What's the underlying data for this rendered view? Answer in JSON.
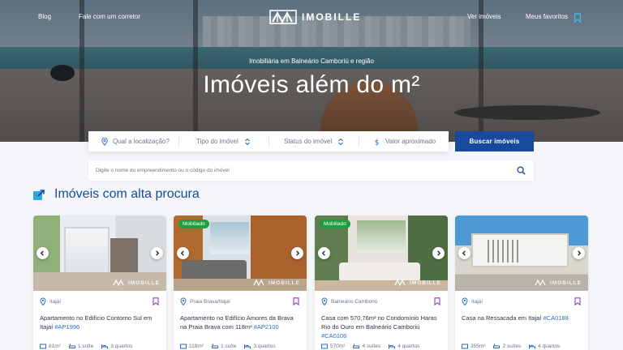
{
  "brand": {
    "name": "IMOBILLE",
    "accent": "#174a9e",
    "link_color": "#2f6bc4",
    "badge_color": "#1e9e3e"
  },
  "nav": {
    "left": [
      {
        "label": "Blog"
      },
      {
        "label": "Fale com um corretor"
      }
    ],
    "right": [
      {
        "label": "Ver imóveis"
      },
      {
        "label": "Meus favoritos",
        "icon": "bookmark-icon"
      }
    ]
  },
  "hero": {
    "subtitle": "Imobiliária em Balneário Camboriú e região",
    "title": "Imóveis além do m²"
  },
  "search": {
    "location_placeholder": "Qual a localização?",
    "type_label": "Tipo do imóvel",
    "status_label": "Status do imóvel",
    "price_label": "Valor aproximado",
    "button_label": "Buscar imóveis",
    "code_placeholder": "Digite o nome do empreendimento ou o código do imóvel"
  },
  "section": {
    "title": "Imóveis com alta procura",
    "icon": "trending-arrow-icon"
  },
  "cards": [
    {
      "badge": "",
      "location": "Itajaí",
      "title": "Apartamento no Edifício Contorno Sul em Itajaí",
      "code": "#AP1996",
      "area": "81m²",
      "suites": "1 suíte",
      "rooms": "3 quartos",
      "watermark": "IMOBILLE"
    },
    {
      "badge": "Mobiliado",
      "location": "Praia Brava/Itajaí",
      "title": "Apartamento no Edifício Amores da Brava na Praia Brava com 118m²",
      "code": "#AP2100",
      "area": "118m²",
      "suites": "1 suíte",
      "rooms": "3 quartos",
      "watermark": "IMOBILLE"
    },
    {
      "badge": "Mobiliado",
      "location": "Balneário Camboriú",
      "title": "Casa com 570,76m² no Condomínio Haras Rio do Ouro em Balneário Camboriú",
      "code": "#CA0106",
      "area": "570m²",
      "suites": "4 suítes",
      "rooms": "4 quartos",
      "watermark": "IMOBILLE"
    },
    {
      "badge": "",
      "location": "Itajaí",
      "title": "Casa na Ressacada em Itajaí",
      "code": "#CA0188",
      "area": "355m²",
      "suites": "2 suítes",
      "rooms": "4 quartos",
      "watermark": "IMOBILLE"
    }
  ]
}
